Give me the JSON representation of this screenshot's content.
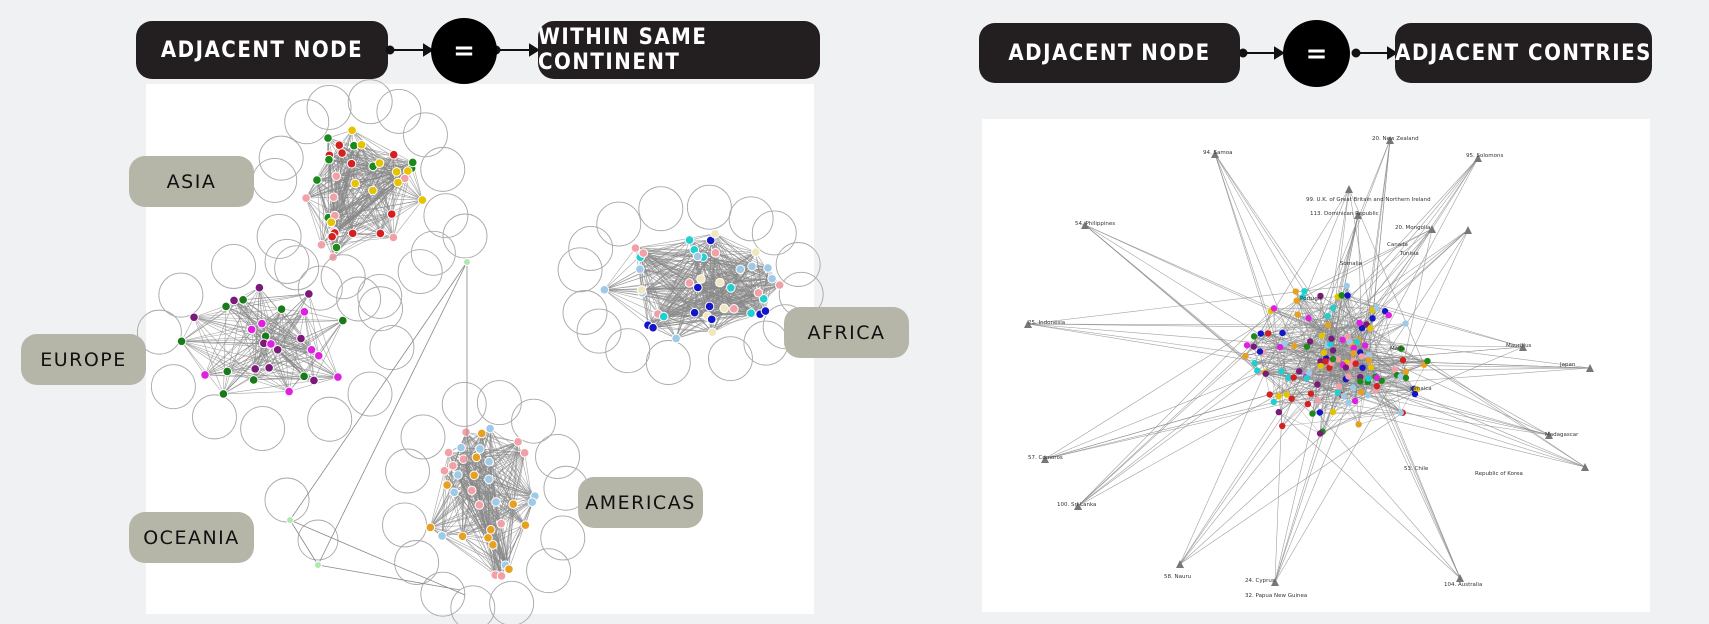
{
  "left_header": {
    "left_term": "ADJACENT NODE",
    "operator": "=",
    "right_term": "WITHIN SAME CONTINENT"
  },
  "right_header": {
    "left_term": "ADJACENT NODE",
    "operator": "=",
    "right_term": "ADJACENT CONTRIES"
  },
  "continent_labels": {
    "asia": "ASIA",
    "europe": "EUROPE",
    "oceania": "OCEANIA",
    "americas": "AMERICAS",
    "africa": "AFRICA"
  },
  "country_nodes": [
    "94. Samoa",
    "20. New Zealand",
    "95. Solomons",
    "99. U.K. of Great Britain and Northern Ireland",
    "113. Dominican Republic",
    "20. Mongolia",
    "54. Philippines",
    "25. Indonesia",
    "57. Comoros",
    "100. Sri Lanka",
    "58. Nauru",
    "32. Papua New Guinea",
    "24. Cyprus",
    "104. Australia",
    "53. Chile",
    "Japan",
    "Madagascar",
    "Mauritius",
    "Tunisia",
    "Canada",
    "Republic of Korea",
    "Somalia",
    "Malta",
    "Jamaica",
    "Portugal"
  ],
  "colors": {
    "asia_nodes": [
      "#e6c300",
      "#d42020",
      "#1a8a1a",
      "#f2a0a8"
    ],
    "europe_nodes": [
      "#1a7a1a",
      "#7a1a7a",
      "#e020e0"
    ],
    "africa_nodes": [
      "#1515c8",
      "#9ecae8",
      "#f0e6c0",
      "#20d0d0",
      "#f2a0a8"
    ],
    "americas_nodes": [
      "#e8a020",
      "#f2a0a8",
      "#9ecae8"
    ],
    "oceania_nodes": [
      "#b0e8b0",
      "#c8d8f0"
    ],
    "edge": "#888888",
    "header_bg": "#231f20",
    "label_bg": "#b5b6a8"
  }
}
